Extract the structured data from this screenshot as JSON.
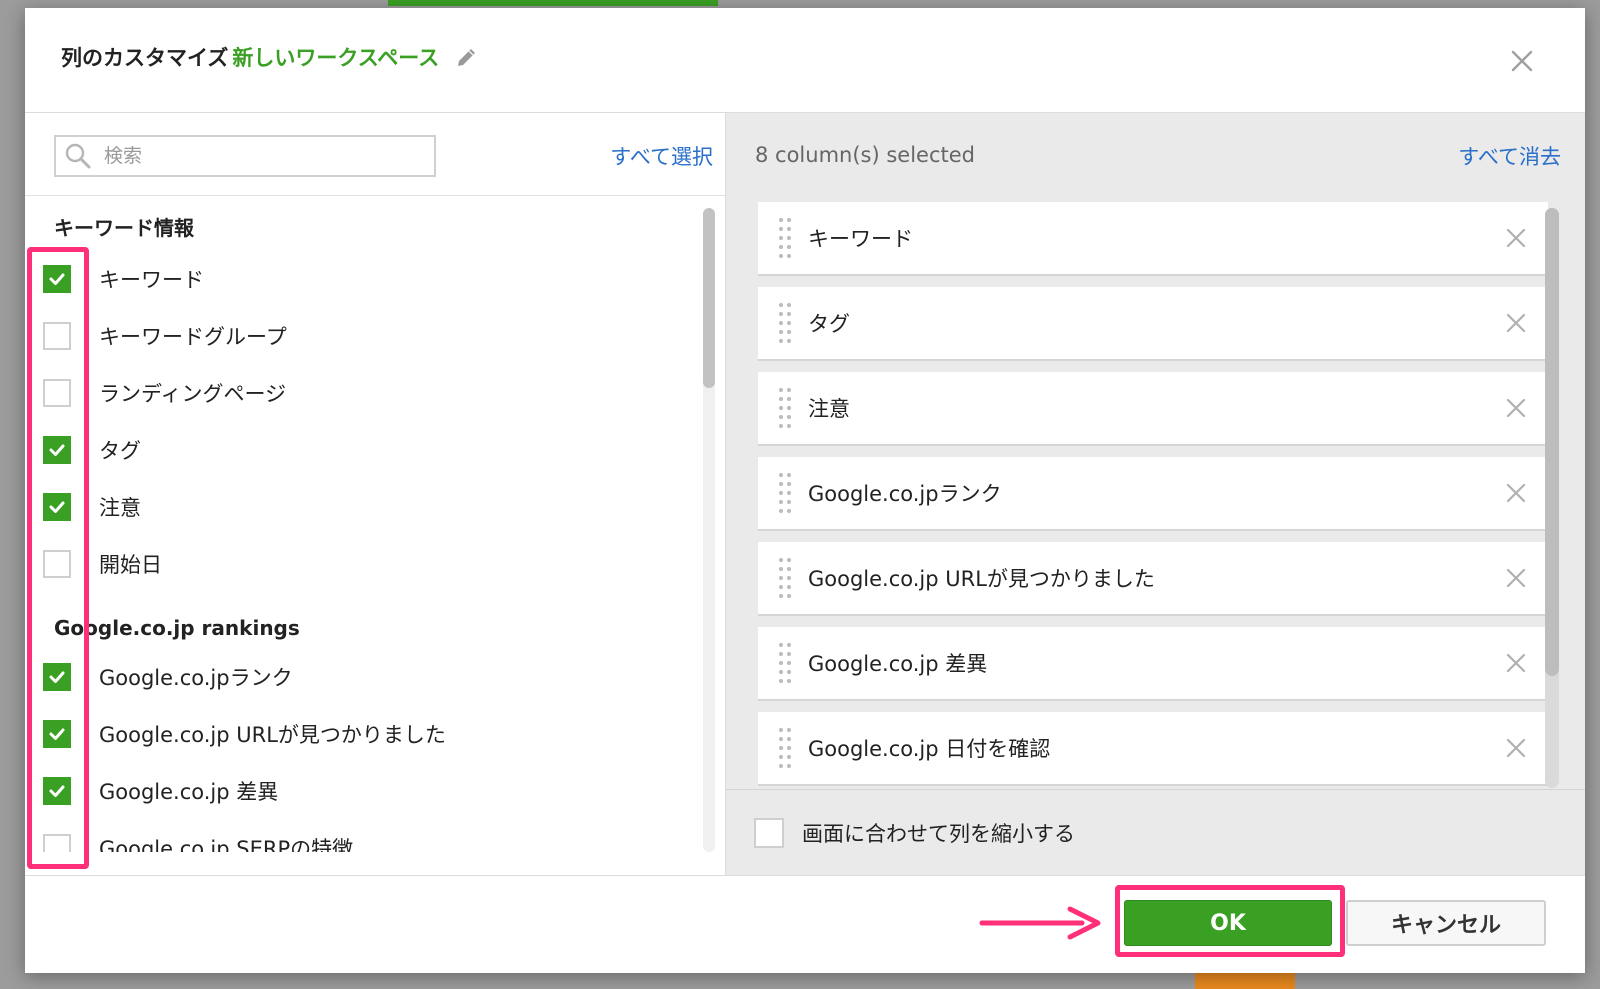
{
  "dialog": {
    "title_prefix": "列のカスタマイズ",
    "workspace_name": "新しいワークスペース"
  },
  "left": {
    "search_placeholder": "検索",
    "select_all": "すべて選択",
    "groups": [
      {
        "header": "キーワード情報",
        "items": [
          {
            "label": "キーワード",
            "checked": true
          },
          {
            "label": "キーワードグループ",
            "checked": false
          },
          {
            "label": "ランディングページ",
            "checked": false
          },
          {
            "label": "タグ",
            "checked": true
          },
          {
            "label": "注意",
            "checked": true
          },
          {
            "label": "開始日",
            "checked": false
          }
        ]
      },
      {
        "header": "Google.co.jp rankings",
        "items": [
          {
            "label": "Google.co.jpランク",
            "checked": true
          },
          {
            "label": "Google.co.jp URLが見つかりました",
            "checked": true
          },
          {
            "label": "Google.co.jp 差異",
            "checked": true
          },
          {
            "label": "Google.co.jp SERPの特徴",
            "checked": false
          }
        ]
      }
    ]
  },
  "right": {
    "selected_count": "8 column(s) selected",
    "clear_all": "すべて消去",
    "selected_items": [
      "キーワード",
      "タグ",
      "注意",
      "Google.co.jpランク",
      "Google.co.jp URLが見つかりました",
      "Google.co.jp 差異",
      "Google.co.jp 日付を確認"
    ],
    "shrink_label": "画面に合わせて列を縮小する",
    "shrink_checked": false
  },
  "footer": {
    "ok": "OK",
    "cancel": "キャンセル"
  },
  "colors": {
    "accent_green": "#3aa023",
    "link_blue": "#2a6fc9",
    "highlight_pink": "#ff2f7a"
  }
}
